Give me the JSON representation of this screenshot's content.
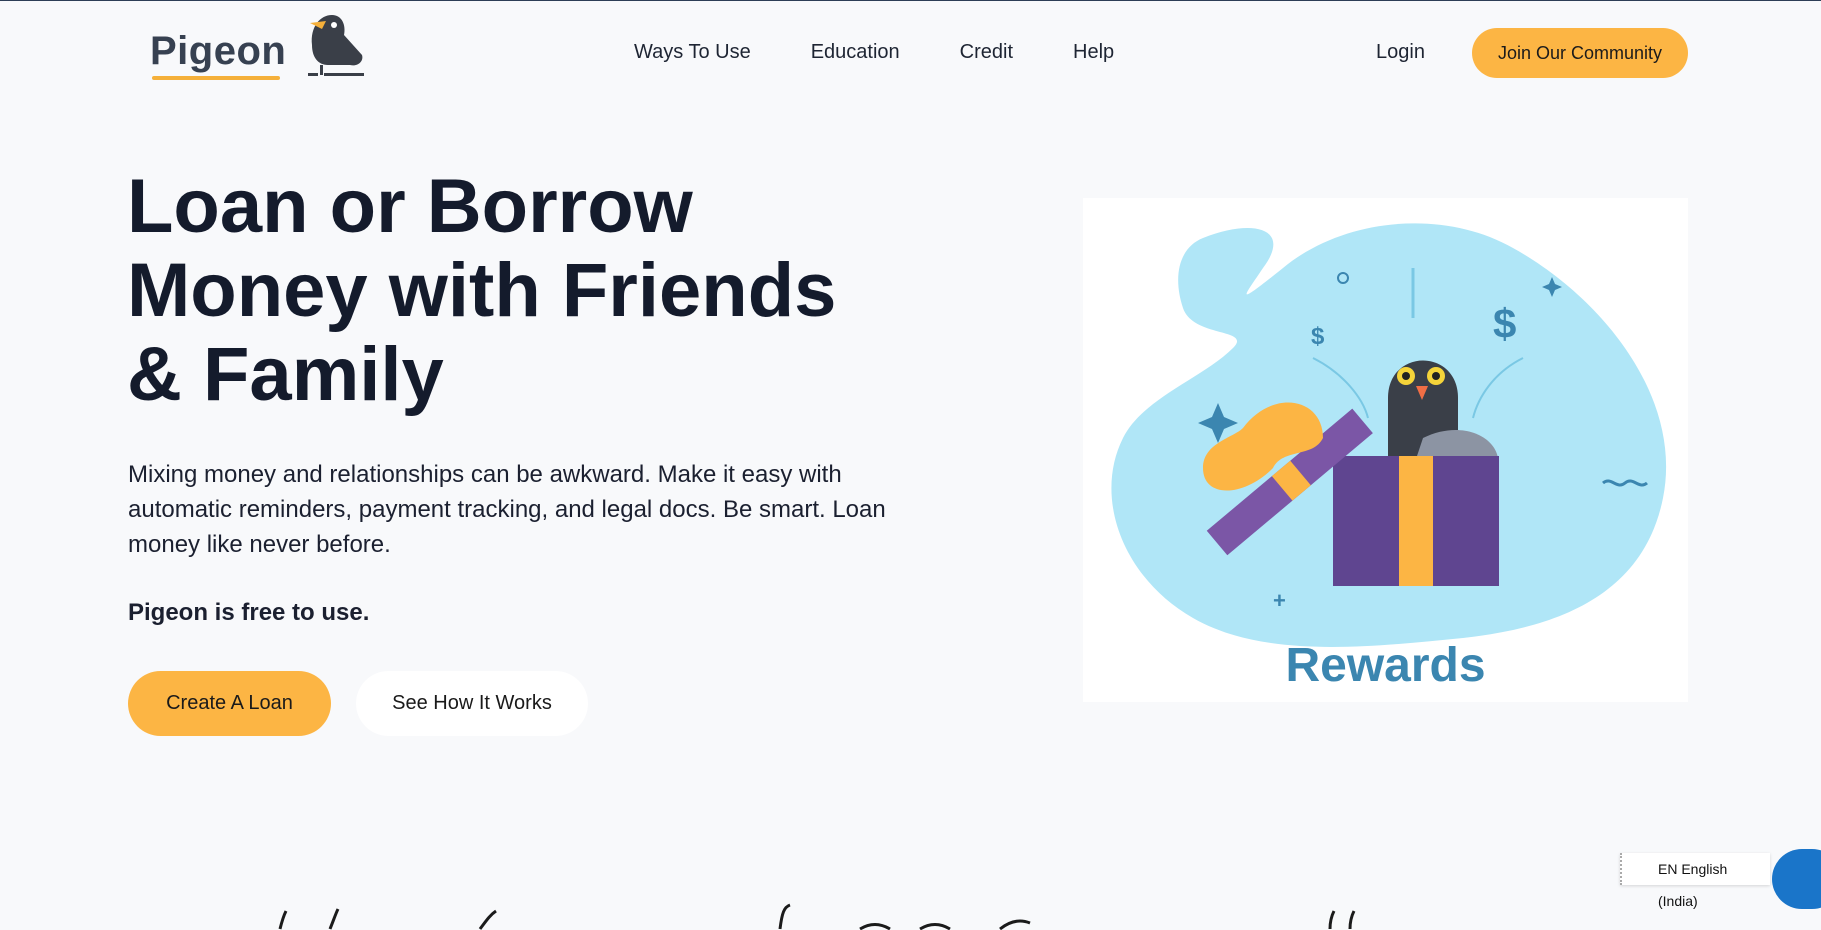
{
  "nav": {
    "logo_text": "Pigeon",
    "links": [
      "Ways To Use",
      "Education",
      "Credit",
      "Help"
    ],
    "login": "Login",
    "join": "Join Our Community"
  },
  "hero": {
    "title": "Loan or Borrow Money with Friends & Family",
    "description": "Mixing money and relationships can be awkward. Make it easy with automatic reminders, payment tracking, and legal docs. Be smart. Loan money like never before.",
    "note": "Pigeon is free to use.",
    "create_button": "Create A Loan",
    "how_button": "See How It Works"
  },
  "illustration": {
    "label": "Rewards",
    "icons": [
      "pigeon-icon",
      "gift-box-icon",
      "dollar-icon"
    ]
  },
  "language": "EN English (India)",
  "colors": {
    "accent": "#fcb544",
    "text": "#141b2c",
    "background": "#f8f9fb",
    "blob": "#b0e6f7",
    "gift": "#5f4590",
    "rewards": "#3b86b0"
  }
}
